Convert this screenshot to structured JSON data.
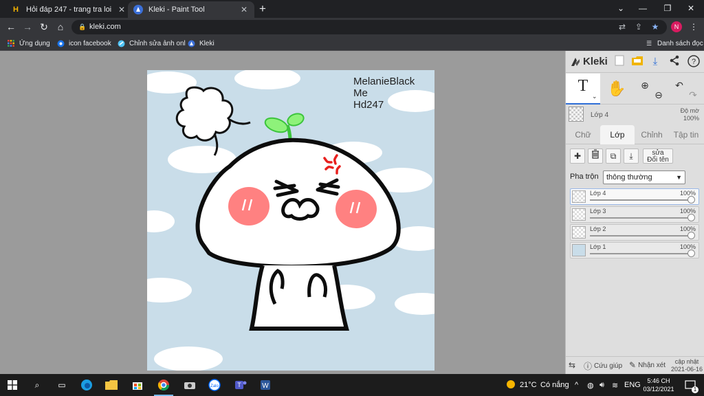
{
  "browser": {
    "tabs": [
      {
        "title": "Hỏi đáp 247 - trang tra loi",
        "icon": "hoidap-favicon"
      },
      {
        "title": "Kleki - Paint Tool",
        "icon": "kleki-favicon"
      }
    ],
    "active_tab": 1,
    "url": "kleki.com",
    "profile_initial": "N",
    "bookmarks": [
      {
        "label": "Ứng dụng",
        "icon": "apps-grid-icon"
      },
      {
        "label": "icon facebook",
        "icon": "globe-icon"
      },
      {
        "label": "Chỉnh sửa ảnh onl",
        "icon": "photo-edit-icon"
      },
      {
        "label": "Kleki",
        "icon": "kleki-favicon"
      }
    ],
    "reading_list": "Danh sách đọc"
  },
  "canvas": {
    "signature_lines": [
      "MelanieBlack",
      "Me",
      "Hd247"
    ],
    "background_color": "#c9dde9"
  },
  "panel": {
    "app_name": "Kleki",
    "current_layer": "Lớp 4",
    "opacity_label": "Độ mờ",
    "opacity_value": "100%",
    "tabs": [
      "Chữ",
      "Lớp",
      "Chỉnh",
      "Tập tin"
    ],
    "active_tab": "Lớp",
    "rename_button": "Đổi tên",
    "rename_overlay": "sửa",
    "blend_label": "Pha trộn",
    "blend_mode": "thông thường",
    "layers": [
      {
        "name": "Lớp 4",
        "opacity": "100%",
        "active": true
      },
      {
        "name": "Lớp 3",
        "opacity": "100%",
        "active": false
      },
      {
        "name": "Lớp 2",
        "opacity": "100%",
        "active": false
      },
      {
        "name": "Lớp 1",
        "opacity": "100%",
        "active": false
      }
    ],
    "help_label": "Cứu giúp",
    "feedback_label": "Nhận xét",
    "update_label": "cập nhật",
    "update_date": "2021-06-16",
    "accent_color": "#2f6fd6"
  },
  "taskbar": {
    "weather_temp": "21°C",
    "weather_text": "Có nắng",
    "language": "ENG",
    "time": "5:46 CH",
    "date": "03/12/2021",
    "notification_count": "1"
  }
}
